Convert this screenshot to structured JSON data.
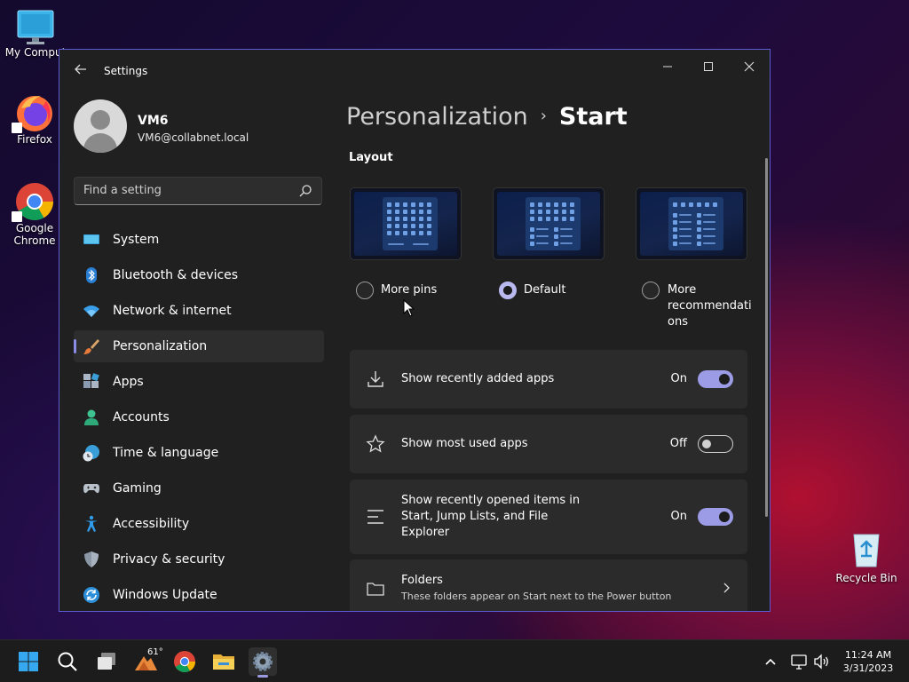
{
  "desktop": {
    "icons": [
      {
        "label": "My Comput",
        "icon": "computer-icon"
      },
      {
        "label": "Firefox",
        "icon": "firefox-icon"
      },
      {
        "label": "Google Chrome",
        "icon": "chrome-icon"
      }
    ],
    "recycle_bin": "Recycle Bin"
  },
  "window": {
    "title": "Settings",
    "controls": {
      "minimize": "—",
      "maximize": "☐",
      "close": "✕"
    }
  },
  "profile": {
    "name": "VM6",
    "email": "VM6@collabnet.local"
  },
  "search": {
    "placeholder": "Find a setting"
  },
  "sidebar": {
    "items": [
      {
        "label": "System",
        "icon": "system-icon"
      },
      {
        "label": "Bluetooth & devices",
        "icon": "bluetooth-icon"
      },
      {
        "label": "Network & internet",
        "icon": "wifi-icon"
      },
      {
        "label": "Personalization",
        "icon": "brush-icon",
        "active": true
      },
      {
        "label": "Apps",
        "icon": "apps-icon"
      },
      {
        "label": "Accounts",
        "icon": "accounts-icon"
      },
      {
        "label": "Time & language",
        "icon": "clock-globe-icon"
      },
      {
        "label": "Gaming",
        "icon": "gamepad-icon"
      },
      {
        "label": "Accessibility",
        "icon": "accessibility-icon"
      },
      {
        "label": "Privacy & security",
        "icon": "shield-icon"
      },
      {
        "label": "Windows Update",
        "icon": "update-icon"
      }
    ]
  },
  "main": {
    "breadcrumb": {
      "parent": "Personalization",
      "separator": "›",
      "current": "Start"
    },
    "layout": {
      "title": "Layout",
      "options": [
        {
          "label": "More pins",
          "selected": false
        },
        {
          "label": "Default",
          "selected": true
        },
        {
          "label": "More recommendations",
          "line1": "More",
          "line2": "recommendati",
          "line3": "ons",
          "selected": false
        }
      ]
    },
    "settings": [
      {
        "label": "Show recently added apps",
        "state": "On",
        "icon": "download-icon"
      },
      {
        "label": "Show most used apps",
        "state": "Off",
        "icon": "star-icon"
      },
      {
        "label_line1": "Show recently opened items in",
        "label_line2": "Start, Jump Lists, and File",
        "label_line3": "Explorer",
        "state": "On",
        "icon": "list-icon"
      }
    ],
    "folders": {
      "label": "Folders",
      "description": "These folders appear on Start next to the Power button",
      "icon": "folder-icon"
    }
  },
  "taskbar": {
    "weather_temp": "61°",
    "time": "11:24 AM",
    "date": "3/31/2023"
  },
  "colors": {
    "accent": "#9b9be6",
    "window_bg": "#202020",
    "card_bg": "#2b2b2b"
  }
}
